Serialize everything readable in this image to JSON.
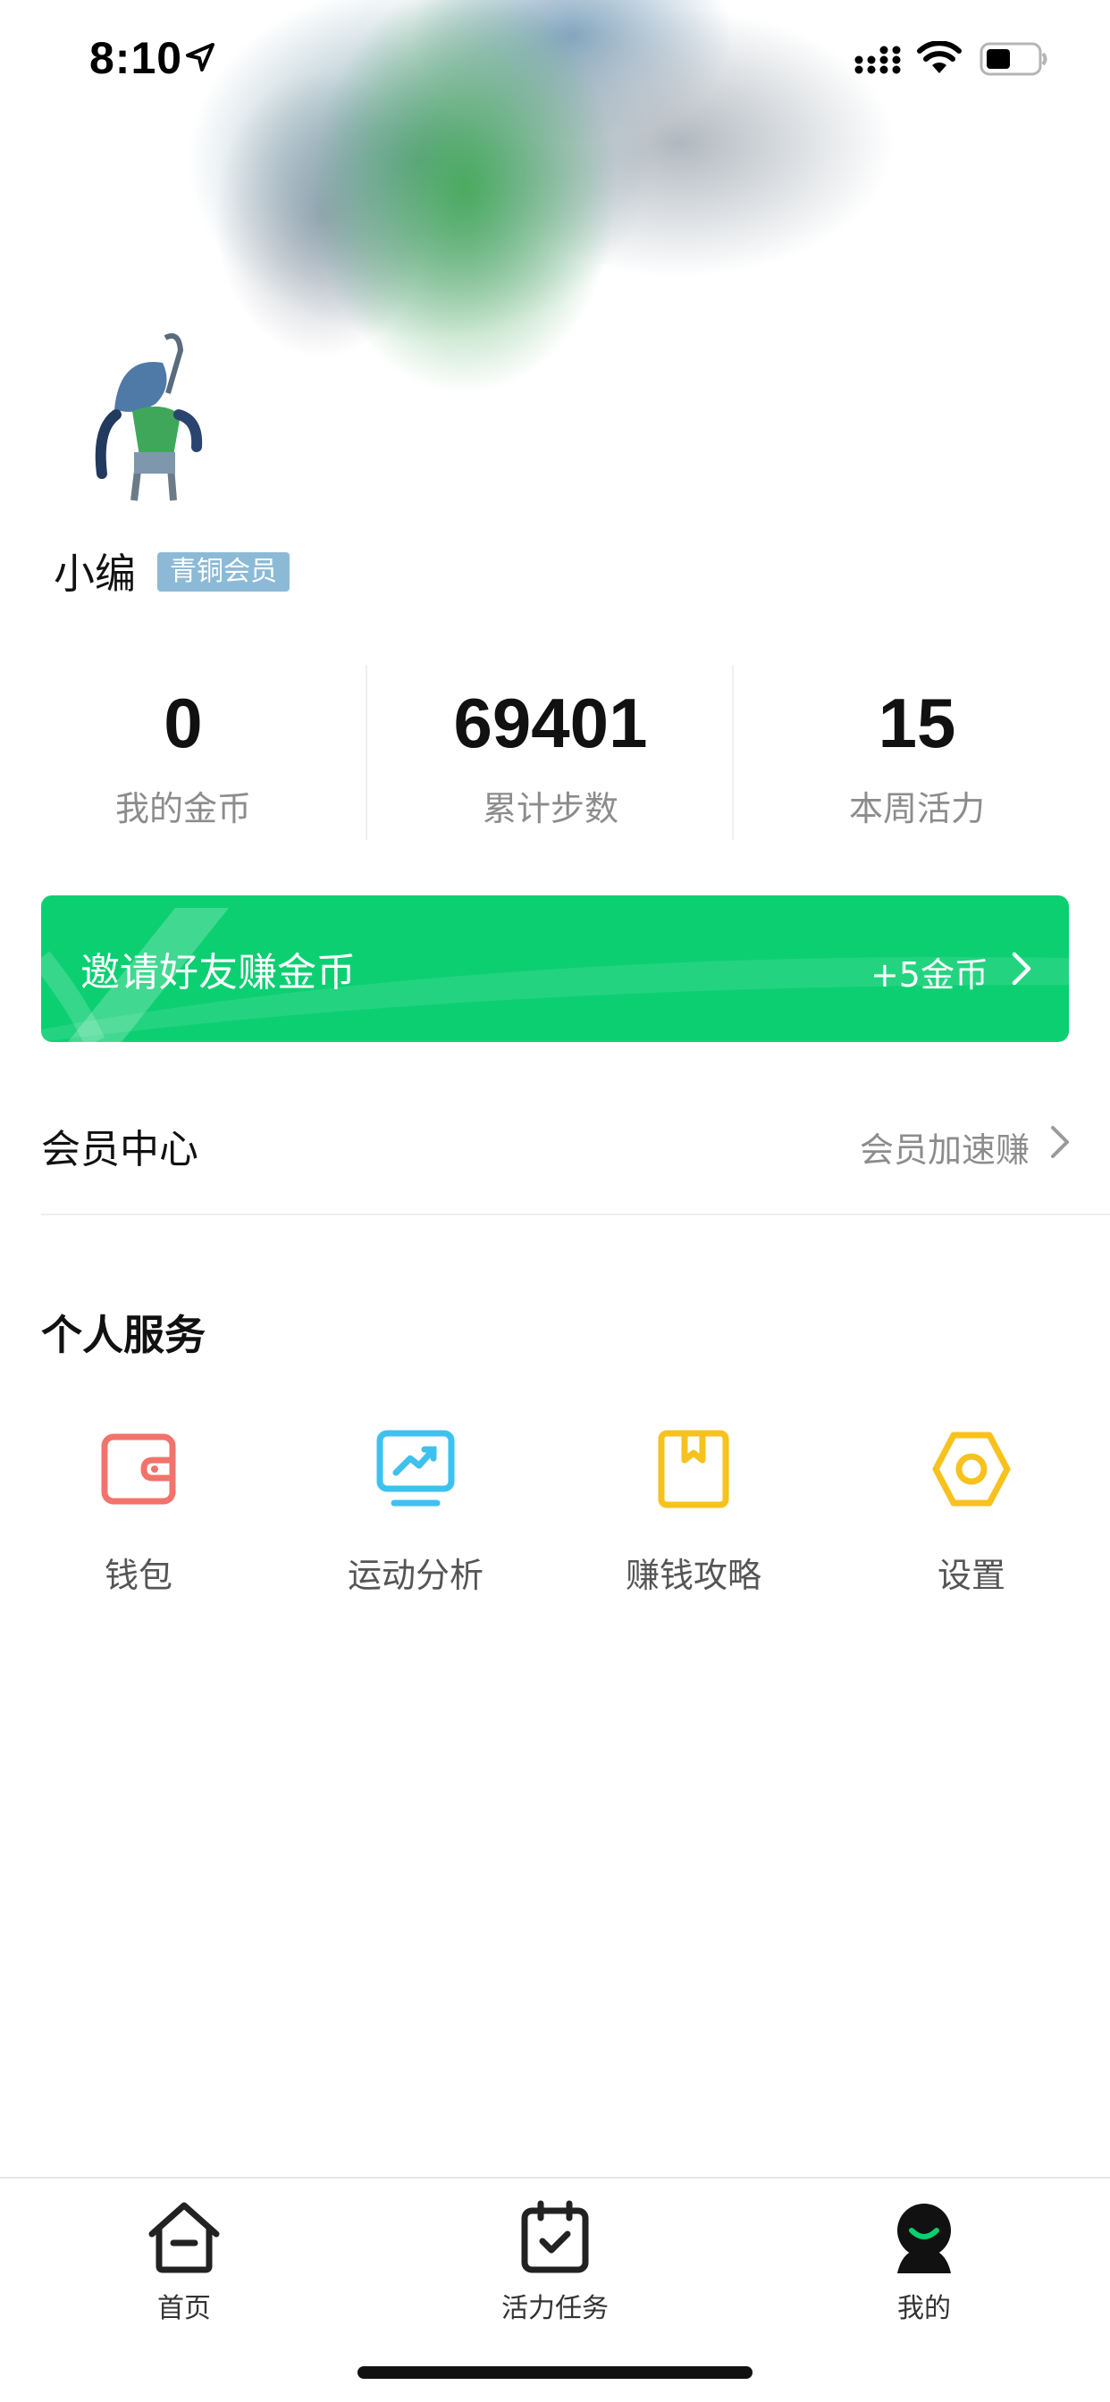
{
  "status_bar": {
    "time": "8:10",
    "icons": [
      "location-arrow-icon",
      "signal-icon",
      "wifi-icon",
      "battery-icon"
    ]
  },
  "profile": {
    "username": "小编",
    "badge": "青铜会员",
    "badge_color": "#8cbad6"
  },
  "stats": [
    {
      "value": "0",
      "label": "我的金币"
    },
    {
      "value": "69401",
      "label": "累计步数"
    },
    {
      "value": "15",
      "label": "本周活力"
    }
  ],
  "invite": {
    "text": "邀请好友赚金币",
    "reward": "+5金币",
    "color": "#0ccf72"
  },
  "member_center": {
    "title": "会员中心",
    "subtitle": "会员加速赚"
  },
  "services": {
    "title": "个人服务",
    "items": [
      {
        "label": "钱包",
        "icon": "wallet-icon",
        "color": "#f2736b"
      },
      {
        "label": "运动分析",
        "icon": "analysis-monitor-icon",
        "color": "#3ec1ef"
      },
      {
        "label": "赚钱攻略",
        "icon": "guide-book-icon",
        "color": "#f7c21d"
      },
      {
        "label": "设置",
        "icon": "settings-hexagon-icon",
        "color": "#f7c21d"
      }
    ]
  },
  "tab_bar": {
    "items": [
      {
        "label": "首页",
        "icon": "home-icon"
      },
      {
        "label": "活力任务",
        "icon": "calendar-check-icon"
      },
      {
        "label": "我的",
        "icon": "profile-icon",
        "selected": true
      }
    ],
    "accent": "#0ccf72"
  }
}
